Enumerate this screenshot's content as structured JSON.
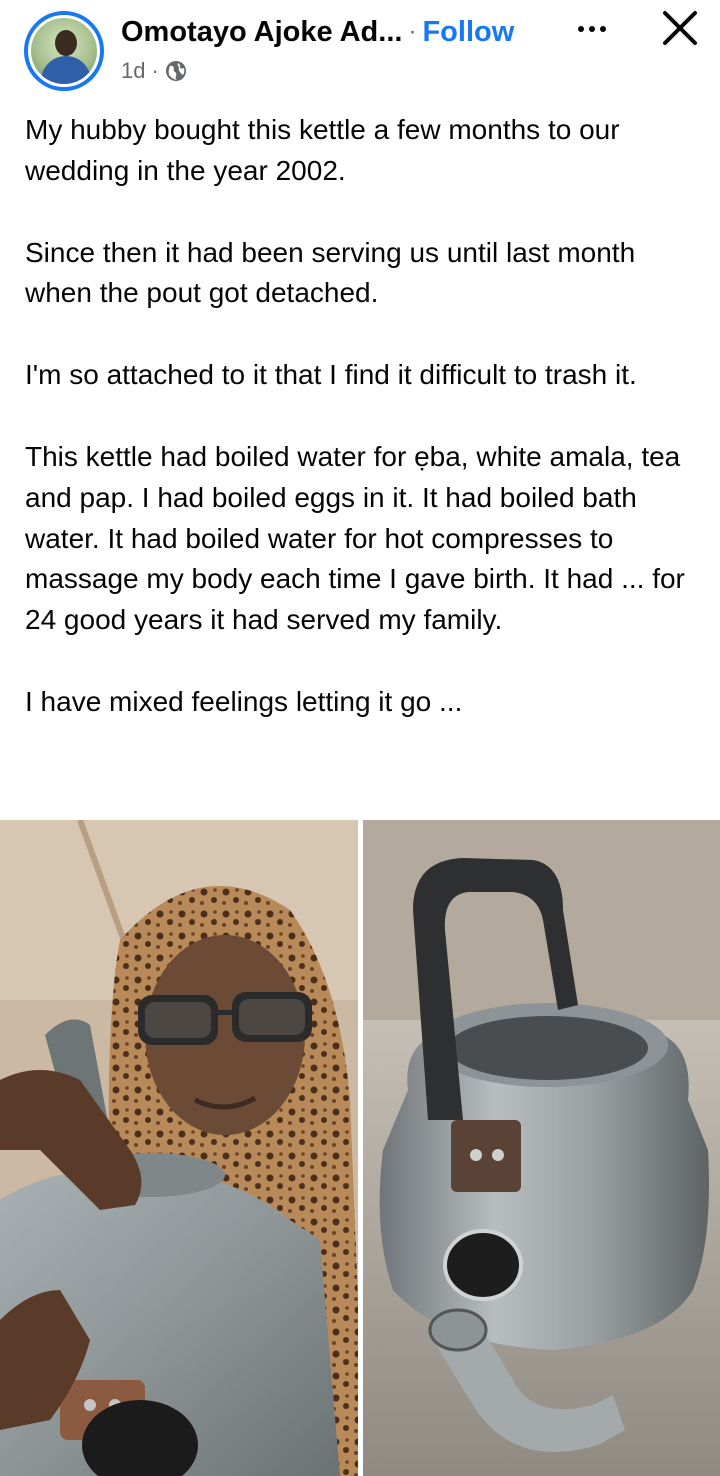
{
  "post": {
    "author_name": "Omotayo Ajoke Ad...",
    "follow_label": "Follow",
    "separator": "·",
    "time": "1d",
    "audience_icon": "globe-icon",
    "paragraphs": [
      "My hubby bought this kettle a few months to our wedding in the year 2002.",
      "Since then it had been serving us until last month when the pout got detached.",
      "I'm so attached to it that I find it difficult to trash it.",
      "This kettle had boiled water for ẹba, white amala, tea and pap. I had boiled eggs in it. It had boiled bath water. It had boiled water for hot compresses to massage my body each time I gave birth.  It had ...   for 24 good years it had served my family.",
      "I have mixed feelings letting it go  ..."
    ]
  },
  "icons": {
    "more": "more-options-icon",
    "close": "close-icon"
  },
  "colors": {
    "accent": "#1877f2",
    "text": "#050505",
    "secondary_text": "#65676b"
  }
}
